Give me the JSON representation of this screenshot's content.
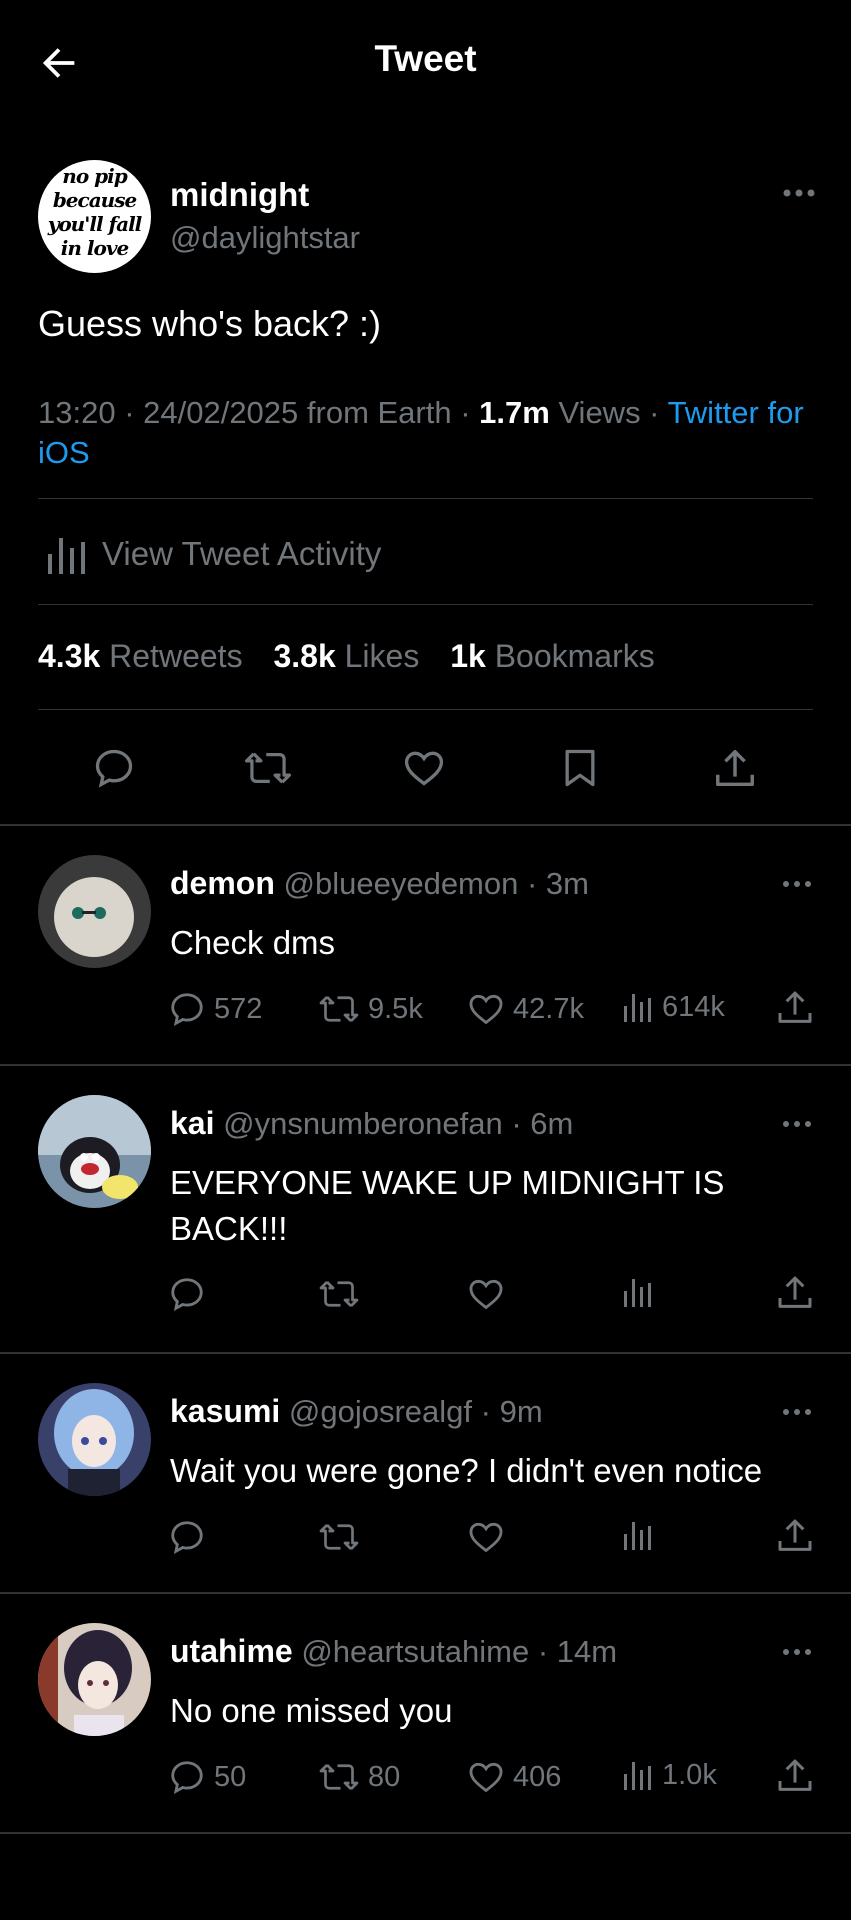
{
  "header": {
    "title": "Tweet",
    "back_icon": "arrow-left-icon"
  },
  "main_tweet": {
    "avatar_text": "no pip because you'll fall in love",
    "name": "midnight",
    "handle": "@daylightstar",
    "text": "Guess who's back? :)",
    "time": "13:20 · 24/02/2025 from Earth · ",
    "views_count": "1.7m",
    "views_label": " Views · ",
    "client": "Twitter for iOS",
    "activity_label": "View Tweet Activity",
    "retweets_count": "4.3k",
    "retweets_label": "Retweets",
    "likes_count": "3.8k",
    "likes_label": "Likes",
    "bookmarks_count": "1k",
    "bookmarks_label": "Bookmarks"
  },
  "replies": [
    {
      "name": "demon",
      "handle": "@blueeyedemon · 3m",
      "text": "Check dms",
      "replies": "572",
      "retweets": "9.5k",
      "likes": "42.7k",
      "views": "614k",
      "avatar_color": "#d8d3cc"
    },
    {
      "name": "kai",
      "handle": "@ynsnumberonefan · 6m",
      "text": "EVERYONE WAKE UP MIDNIGHT IS BACK!!!",
      "replies": "",
      "retweets": "",
      "likes": "",
      "views": "",
      "avatar_color": "#7a93a8"
    },
    {
      "name": "kasumi",
      "handle": "@gojosrealgf · 9m",
      "text": "Wait you were gone? I didn't even notice",
      "replies": "",
      "retweets": "",
      "likes": "",
      "views": "",
      "avatar_color": "#6f8bbd"
    },
    {
      "name": "utahime",
      "handle": "@heartsutahime · 14m",
      "text": "No one missed you",
      "replies": "50",
      "retweets": "80",
      "likes": "406",
      "views": "1.0k",
      "avatar_color": "#c7b9ad"
    }
  ],
  "colors": {
    "background": "#000000",
    "text": "#e7e9ea",
    "secondary": "#71767b",
    "link": "#1d9bf0",
    "divider": "#2f3336"
  }
}
